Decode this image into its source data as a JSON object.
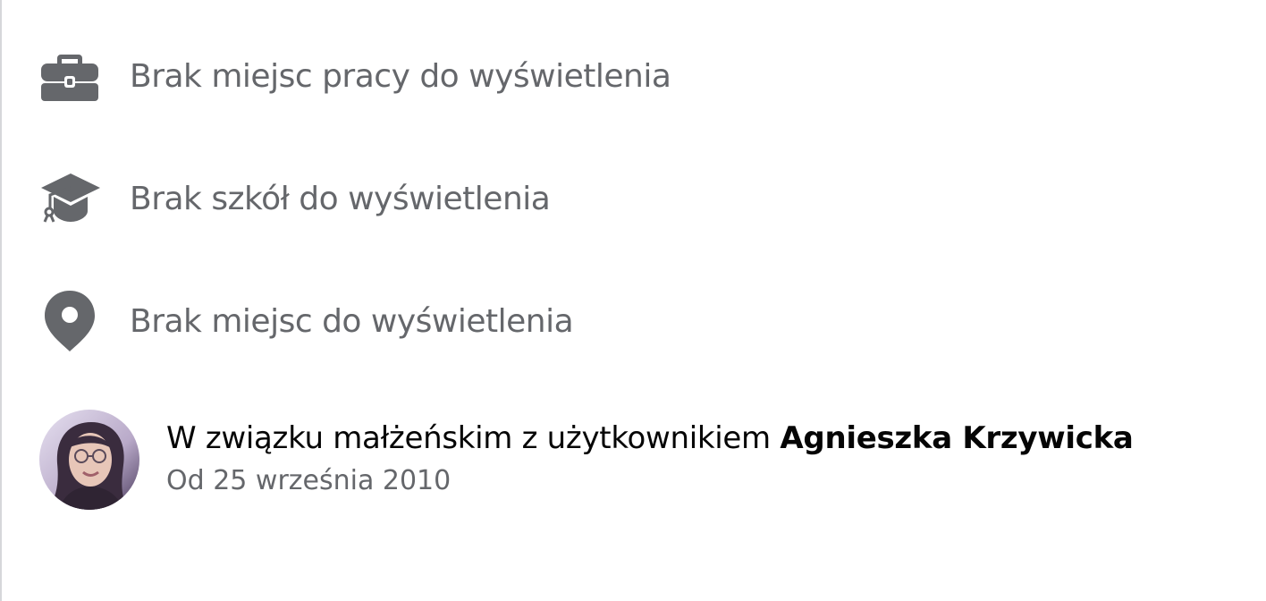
{
  "about": {
    "work": {
      "icon": "briefcase-icon",
      "text": "Brak miejsc pracy do wyświetlenia"
    },
    "education": {
      "icon": "graduation-cap-icon",
      "text": "Brak szkół do wyświetlenia"
    },
    "places": {
      "icon": "location-pin-icon",
      "text": "Brak miejsc do wyświetlenia"
    },
    "relationship": {
      "status_text": "W związku małżeńskim z użytkownikiem",
      "partner_name": "Agnieszka Krzywicka",
      "since": "Od 25 września 2010"
    }
  },
  "colors": {
    "icon": "#65676b",
    "secondary_text": "#65676b",
    "primary_text": "#050505",
    "divider": "#d6d7da"
  }
}
